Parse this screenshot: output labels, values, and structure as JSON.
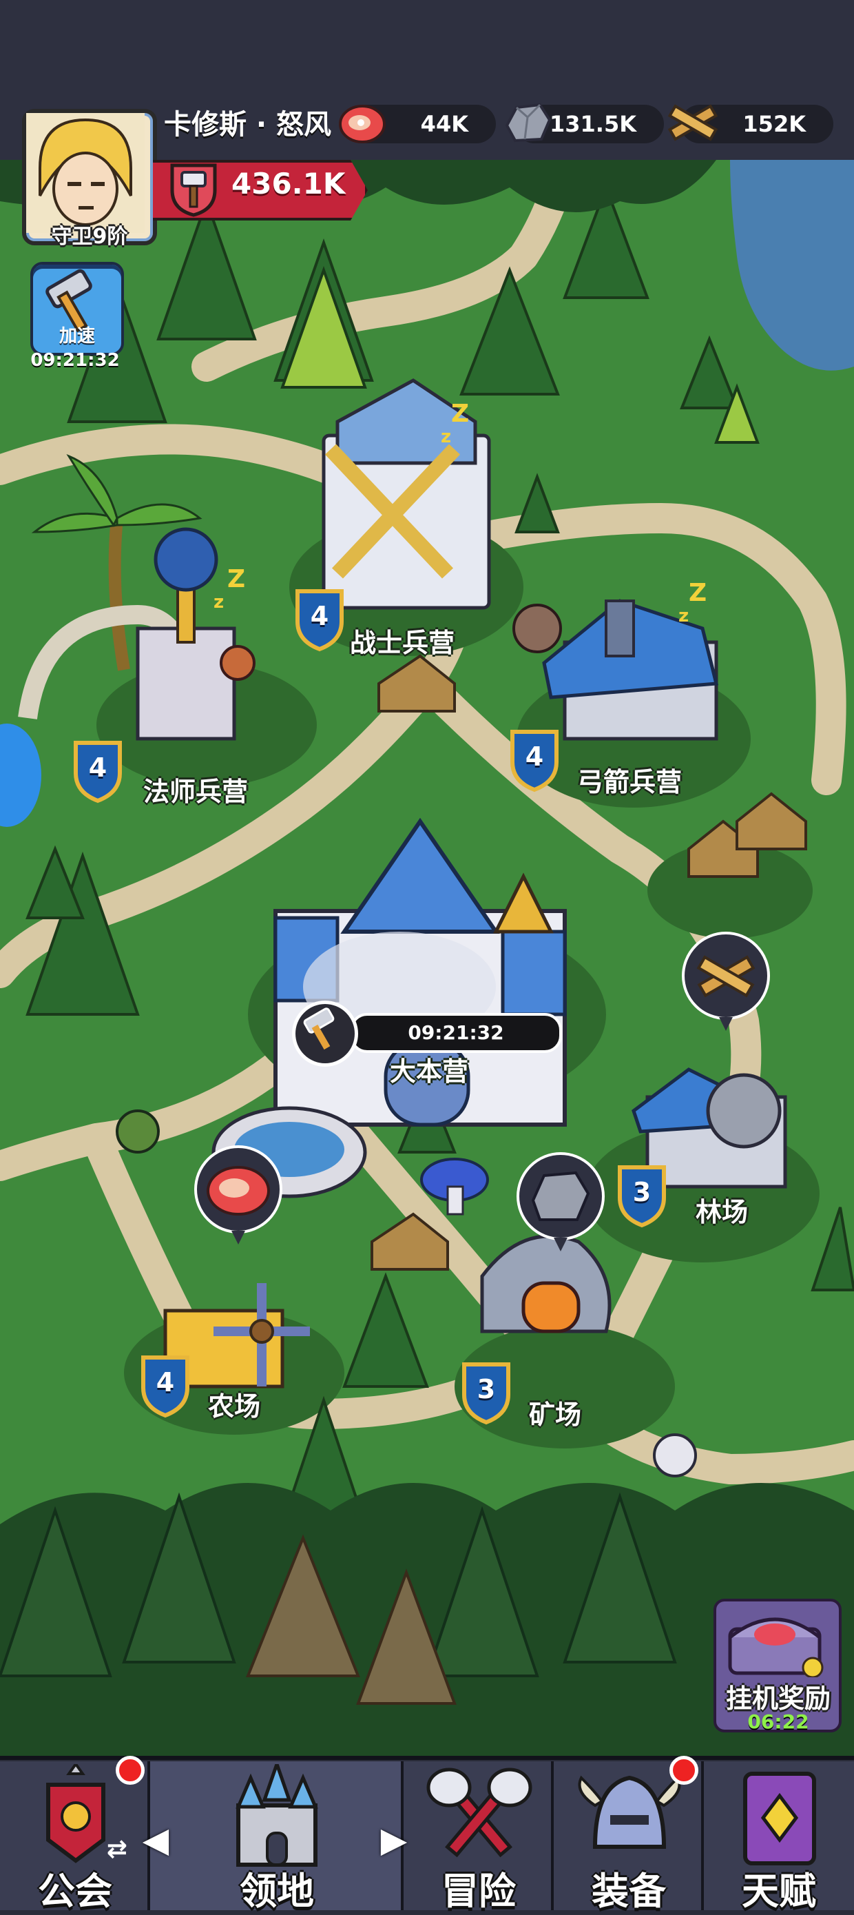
{
  "player": {
    "name": "卡修斯 · 怒风",
    "rank": "守卫9阶",
    "power": "436.1K"
  },
  "resources": [
    {
      "icon": "meat-icon",
      "value": "44K"
    },
    {
      "icon": "stone-icon",
      "value": "131.5K"
    },
    {
      "icon": "wood-icon",
      "value": "152K"
    }
  ],
  "speedup": {
    "label": "加速",
    "timer": "09:21:32"
  },
  "buildings": {
    "warrior": {
      "name": "战士兵营",
      "level": "4"
    },
    "mage": {
      "name": "法师兵营",
      "level": "4"
    },
    "archer": {
      "name": "弓箭兵营",
      "level": "4"
    },
    "hq": {
      "name": "大本营",
      "timer": "09:21:32"
    },
    "lumber": {
      "name": "林场",
      "level": "3"
    },
    "farm": {
      "name": "农场",
      "level": "4"
    },
    "mine": {
      "name": "矿场",
      "level": "3"
    }
  },
  "idle_reward": {
    "label": "挂机奖励",
    "timer": "06:22"
  },
  "nav": [
    {
      "label": "公会",
      "icon": "guild-banner-icon",
      "badge": true
    },
    {
      "label": "领地",
      "icon": "castle-icon",
      "badge": false,
      "active": true
    },
    {
      "label": "冒险",
      "icon": "crossed-axes-icon",
      "badge": false
    },
    {
      "label": "装备",
      "icon": "helmet-icon",
      "badge": true
    },
    {
      "label": "天赋",
      "icon": "spellbook-icon",
      "badge": false
    }
  ],
  "colors": {
    "accent_red": "#c4243a",
    "shield_blue": "#1e5fb0",
    "grass": "#3f8a3c",
    "path": "#d8c9a4"
  }
}
